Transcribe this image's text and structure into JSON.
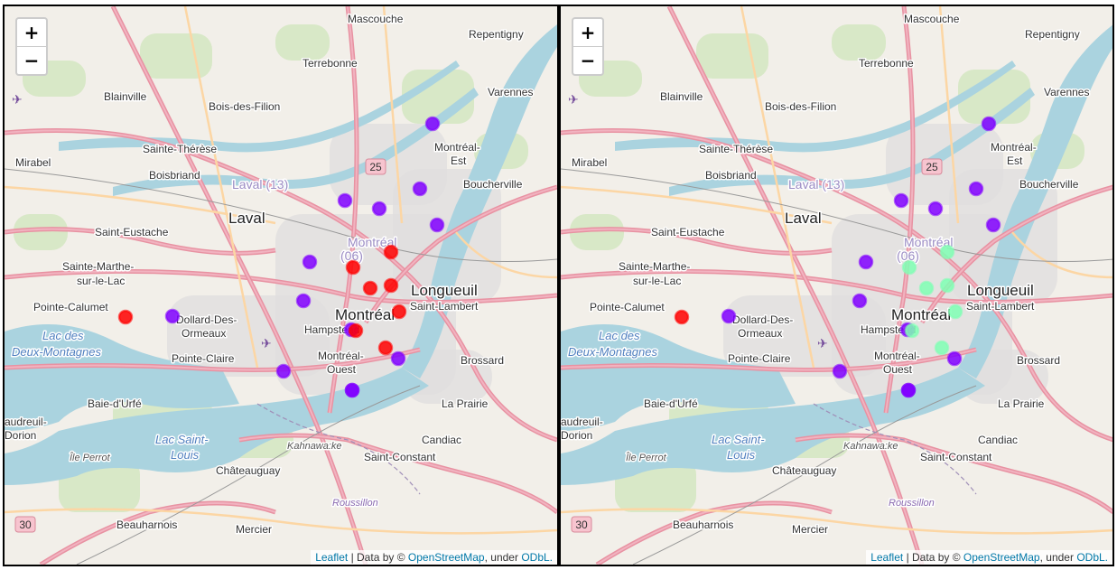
{
  "map": {
    "zoom_in_label": "+",
    "zoom_out_label": "−",
    "attribution": {
      "leaflet": "Leaflet",
      "sep": " | Data by © ",
      "osm": "OpenStreetMap",
      "under": ", under ",
      "odbl": "ODbL."
    },
    "labels": [
      {
        "text": "Mascouche",
        "cls": "place"
      },
      {
        "text": "Repentigny",
        "cls": "place"
      },
      {
        "text": "Terrebonne",
        "cls": "place"
      },
      {
        "text": "Blainville",
        "cls": "place"
      },
      {
        "text": "Bois-des-Filion",
        "cls": "place"
      },
      {
        "text": "Varennes",
        "cls": "place"
      },
      {
        "text": "Sainte-Thérèse",
        "cls": "place"
      },
      {
        "text": "Montréal-",
        "cls": "place"
      },
      {
        "text": "Est",
        "cls": "place"
      },
      {
        "text": "Mirabel",
        "cls": "place"
      },
      {
        "text": "Boisbriand",
        "cls": "place"
      },
      {
        "text": "Laval (13)",
        "cls": "place region"
      },
      {
        "text": "Boucherville",
        "cls": "place"
      },
      {
        "text": "Laval",
        "cls": "place big"
      },
      {
        "text": "Saint-Eustache",
        "cls": "place"
      },
      {
        "text": "Montréal",
        "cls": "place region"
      },
      {
        "text": "(06)",
        "cls": "place region"
      },
      {
        "text": "Sainte-Marthe-",
        "cls": "place"
      },
      {
        "text": "sur-le-Lac",
        "cls": "place"
      },
      {
        "text": "Longueuil",
        "cls": "place big"
      },
      {
        "text": "Pointe-Calumet",
        "cls": "place"
      },
      {
        "text": "Dollard-Des-",
        "cls": "place"
      },
      {
        "text": "Ormeaux",
        "cls": "place"
      },
      {
        "text": "Montréal",
        "cls": "place big"
      },
      {
        "text": "Saint-Lambert",
        "cls": "place"
      },
      {
        "text": "Hampstead",
        "cls": "place"
      },
      {
        "text": "Lac des",
        "cls": "place water"
      },
      {
        "text": "Deux-Montagnes",
        "cls": "place water"
      },
      {
        "text": "Pointe-Claire",
        "cls": "place"
      },
      {
        "text": "Montréal-",
        "cls": "place"
      },
      {
        "text": "Ouest",
        "cls": "place"
      },
      {
        "text": "Brossard",
        "cls": "place"
      },
      {
        "text": "Baie-d'Urfé",
        "cls": "place"
      },
      {
        "text": "La Prairie",
        "cls": "place"
      },
      {
        "text": "audreuil-",
        "cls": "place"
      },
      {
        "text": "Dorion",
        "cls": "place"
      },
      {
        "text": "Lac Saint-",
        "cls": "place water"
      },
      {
        "text": "Louis",
        "cls": "place water"
      },
      {
        "text": "Kahnawa:ke",
        "cls": "place reserve"
      },
      {
        "text": "Candiac",
        "cls": "place"
      },
      {
        "text": "Île Perrot",
        "cls": "place reserve"
      },
      {
        "text": "Saint-Constant",
        "cls": "place"
      },
      {
        "text": "Châteauguay",
        "cls": "place"
      },
      {
        "text": "Roussillon",
        "cls": "place rcm"
      },
      {
        "text": "Beauharnois",
        "cls": "place"
      },
      {
        "text": "Mercier",
        "cls": "place"
      }
    ],
    "shields": [
      "25",
      "30"
    ],
    "colors": {
      "red": "#ff0000",
      "purple": "#8000ff",
      "light_green": "#80ffb4"
    }
  },
  "maps": [
    {
      "id": "left",
      "markers": [
        "purple",
        "purple",
        "purple",
        "purple",
        "purple",
        "red",
        "purple",
        "red",
        "red",
        "red",
        "red",
        "purple",
        "red",
        "purple",
        "purple",
        "red",
        "purple",
        "red",
        "purple",
        "purple",
        "purple"
      ]
    },
    {
      "id": "right",
      "markers": [
        "purple",
        "purple",
        "purple",
        "purple",
        "purple",
        "light_green",
        "purple",
        "light_green",
        "light_green",
        "light_green",
        "light_green",
        "purple",
        "light_green",
        "purple",
        "purple",
        "light_green",
        "purple",
        "red",
        "purple",
        "purple",
        "purple"
      ]
    }
  ]
}
